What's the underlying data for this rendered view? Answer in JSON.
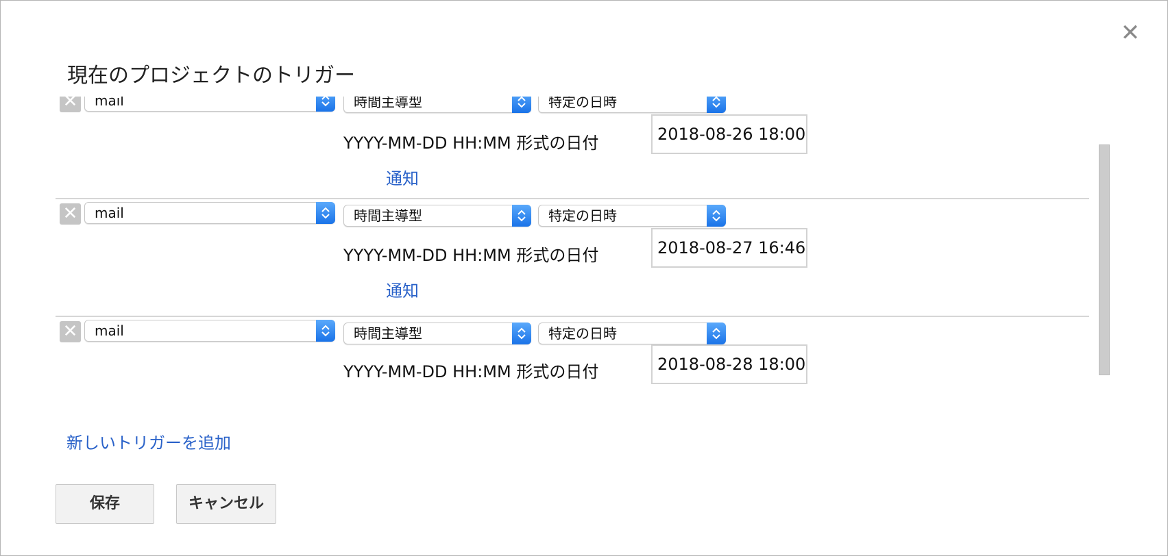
{
  "dialog": {
    "title": "現在のプロジェクトのトリガー",
    "close_icon": "close-icon"
  },
  "triggers": [
    {
      "function": "mail",
      "event_source": "時間主導型",
      "event_type": "特定の日時",
      "date_label": "YYYY-MM-DD HH:MM 形式の日付",
      "date_value": "2018-08-26 18:00",
      "notify_link": "通知"
    },
    {
      "function": "mail",
      "event_source": "時間主導型",
      "event_type": "特定の日時",
      "date_label": "YYYY-MM-DD HH:MM 形式の日付",
      "date_value": "2018-08-27 16:46",
      "notify_link": "通知"
    },
    {
      "function": "mail",
      "event_source": "時間主導型",
      "event_type": "特定の日時",
      "date_label": "YYYY-MM-DD HH:MM 形式の日付",
      "date_value": "2018-08-28 18:00",
      "notify_link": ""
    }
  ],
  "add_trigger_link": "新しいトリガーを追加",
  "buttons": {
    "save": "保存",
    "cancel": "キャンセル"
  },
  "colors": {
    "link": "#2a62c9",
    "select_arrow": "#1a73e8"
  }
}
